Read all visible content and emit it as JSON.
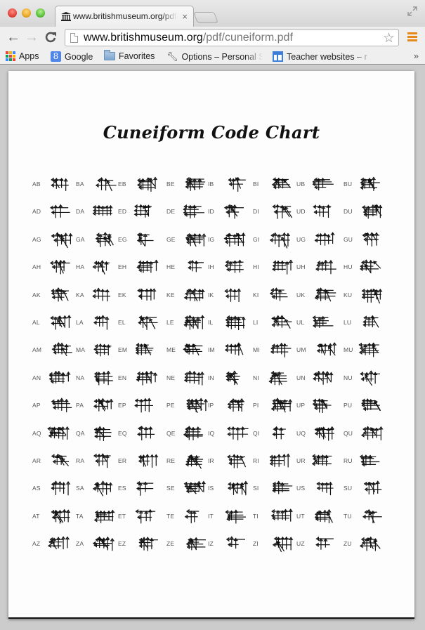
{
  "browser": {
    "tab": {
      "title": "www.britishmuseum.org/pdf/cuneiform.pdf",
      "favicon": "museum-icon",
      "close_glyph": "×"
    },
    "toolbar": {
      "back_glyph": "←",
      "forward_glyph": "→",
      "reload_glyph": "C",
      "url_host": "www.britishmuseum.org",
      "url_path": "/pdf/cuneiform.pdf",
      "star_glyph": "☆"
    },
    "bookmarks": [
      {
        "label": "Apps",
        "icon": "apps-grid-icon"
      },
      {
        "label": "Google",
        "icon": "google-icon"
      },
      {
        "label": "Favorites",
        "icon": "folder-icon"
      },
      {
        "label": "Options – Personal S",
        "icon": "wrench-icon"
      },
      {
        "label": "Teacher websites – r",
        "icon": "site-icon"
      }
    ],
    "overflow_glyph": "»"
  },
  "pdf": {
    "title": "Cuneiform Code Chart",
    "rows": [
      [
        "AB",
        "BA",
        "EB",
        "BE",
        "IB",
        "BI",
        "UB",
        "BU"
      ],
      [
        "AD",
        "DA",
        "ED",
        "DE",
        "ID",
        "DI",
        "UD",
        "DU"
      ],
      [
        "AG",
        "GA",
        "EG",
        "GE",
        "IG",
        "GI",
        "UG",
        "GU"
      ],
      [
        "AH",
        "HA",
        "EH",
        "HE",
        "IH",
        "HI",
        "UH",
        "HU"
      ],
      [
        "AK",
        "KA",
        "EK",
        "KE",
        "IK",
        "KI",
        "UK",
        "KU"
      ],
      [
        "AL",
        "LA",
        "EL",
        "LE",
        "IL",
        "LI",
        "UL",
        "LU"
      ],
      [
        "AM",
        "MA",
        "EM",
        "ME",
        "IM",
        "MI",
        "UM",
        "MU"
      ],
      [
        "AN",
        "NA",
        "EN",
        "NE",
        "IN",
        "NI",
        "UN",
        "NU"
      ],
      [
        "AP",
        "PA",
        "EP",
        "PE",
        "IP",
        "PI",
        "UP",
        "PU"
      ],
      [
        "AQ",
        "QA",
        "EQ",
        "QE",
        "IQ",
        "QI",
        "UQ",
        "QU"
      ],
      [
        "AR",
        "RA",
        "ER",
        "RE",
        "IR",
        "RI",
        "UR",
        "RU"
      ],
      [
        "AS",
        "SA",
        "ES",
        "SE",
        "IS",
        "SI",
        "US",
        "SU"
      ],
      [
        "AT",
        "TA",
        "ET",
        "TE",
        "IT",
        "TI",
        "UT",
        "TU"
      ],
      [
        "AZ",
        "ZA",
        "EZ",
        "ZE",
        "IZ",
        "ZI",
        "UZ",
        "ZU"
      ]
    ]
  }
}
